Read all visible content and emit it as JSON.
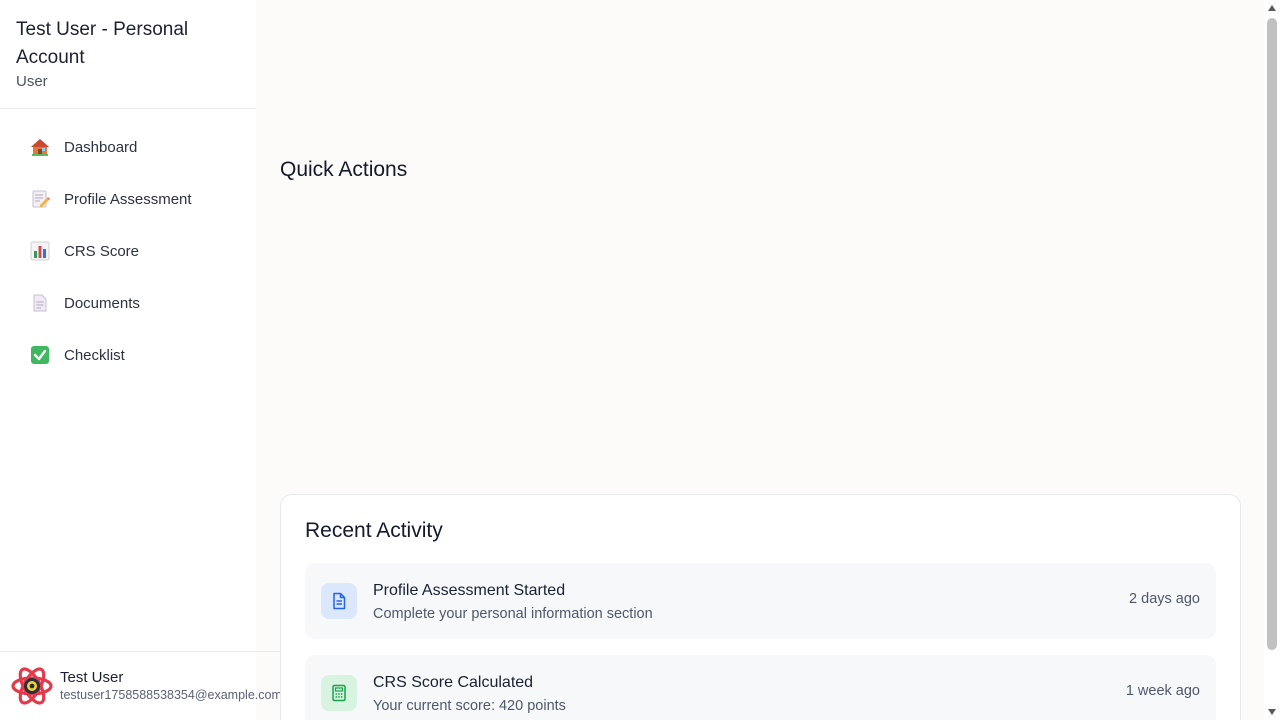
{
  "sidebar": {
    "account_name": "Test User - Personal Account",
    "account_role": "User",
    "nav_items": [
      {
        "label": "Dashboard",
        "icon": "house-icon"
      },
      {
        "label": "Profile Assessment",
        "icon": "memo-icon"
      },
      {
        "label": "CRS Score",
        "icon": "bar-chart-icon"
      },
      {
        "label": "Documents",
        "icon": "document-icon"
      },
      {
        "label": "Checklist",
        "icon": "check-mark-icon"
      }
    ],
    "footer": {
      "user_name": "Test User",
      "user_email": "testuser1758588538354@example.com"
    }
  },
  "main": {
    "quick_actions_title": "Quick Actions",
    "recent_activity": {
      "title": "Recent Activity",
      "items": [
        {
          "title": "Profile Assessment Started",
          "subtitle": "Complete your personal information section",
          "time": "2 days ago",
          "icon": "document-icon",
          "color": "#2563eb"
        },
        {
          "title": "CRS Score Calculated",
          "subtitle": "Your current score: 420 points",
          "time": "1 week ago",
          "icon": "calculator-icon",
          "color": "#16a34a"
        }
      ]
    }
  }
}
